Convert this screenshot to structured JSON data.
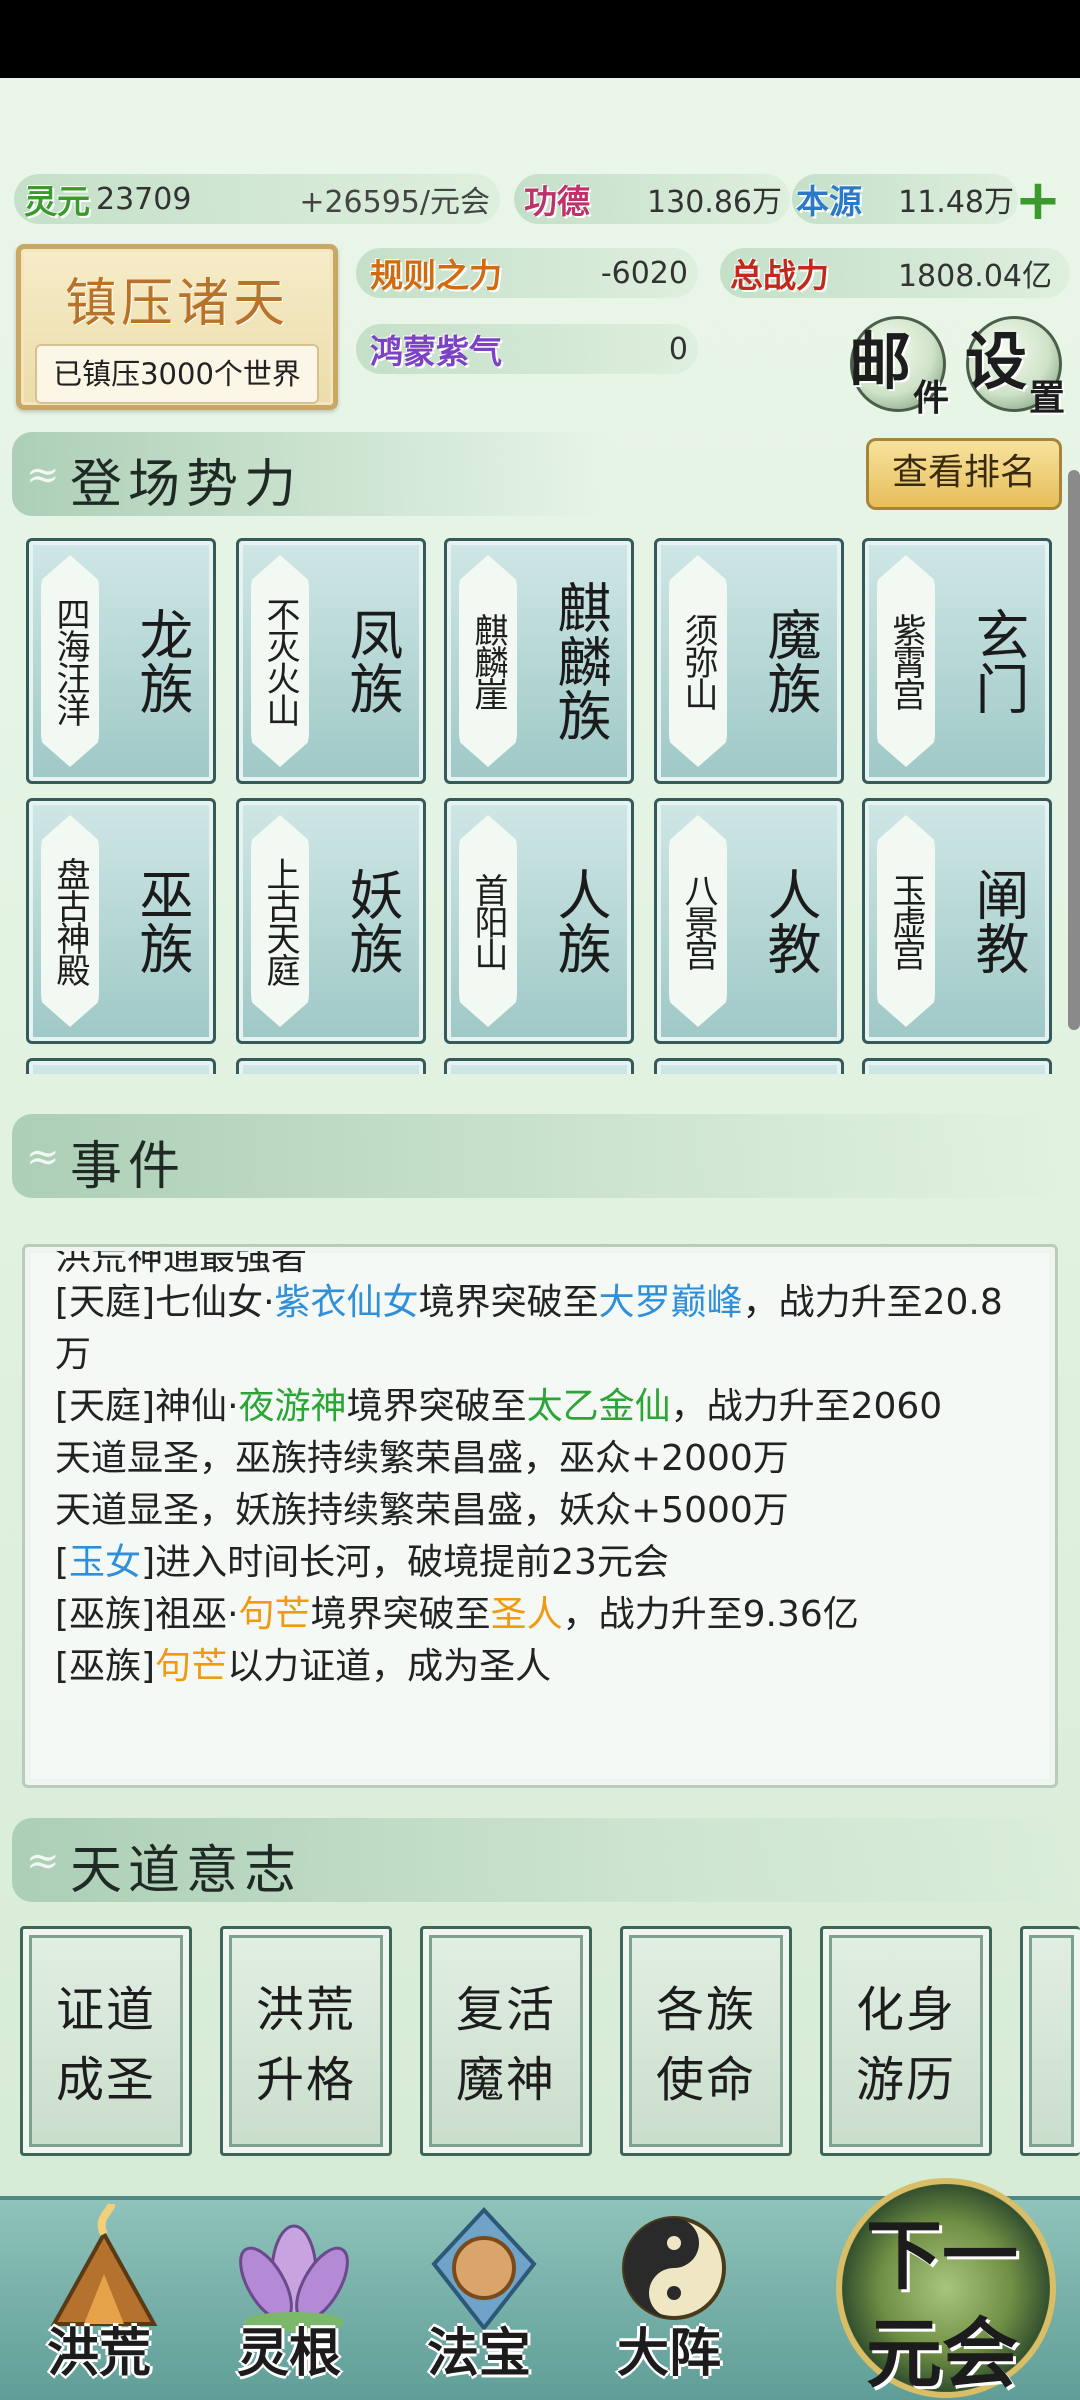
{
  "resources": {
    "lingyuan": {
      "label": "灵元",
      "value": "23709",
      "rate": "+26595/元会"
    },
    "gongde": {
      "label": "功德",
      "value": "130.86万"
    },
    "benyuan": {
      "label": "本源",
      "value": "11.48万"
    },
    "guize": {
      "label": "规则之力",
      "value": "-6020"
    },
    "zongzhanli": {
      "label": "总战力",
      "value": "1808.04亿"
    },
    "hongmeng": {
      "label": "鸿蒙紫气",
      "value": "0"
    }
  },
  "suppress": {
    "title": "镇压诸天",
    "subtitle": "已镇压3000个世界"
  },
  "buttons": {
    "mail": {
      "big": "邮",
      "small": "件"
    },
    "settings": {
      "big": "设",
      "small": "置"
    },
    "plus": "+"
  },
  "factions_section": {
    "title": "登场势力",
    "rank_button": "查看排名"
  },
  "factions": [
    {
      "place": "四海汪洋",
      "name": "龙族"
    },
    {
      "place": "不灭火山",
      "name": "凤族"
    },
    {
      "place": "麒麟崖",
      "name": "麒麟族"
    },
    {
      "place": "须弥山",
      "name": "魔族"
    },
    {
      "place": "紫霄宫",
      "name": "玄门"
    },
    {
      "place": "盘古神殿",
      "name": "巫族"
    },
    {
      "place": "上古天庭",
      "name": "妖族"
    },
    {
      "place": "首阳山",
      "name": "人族"
    },
    {
      "place": "八景宫",
      "name": "人教"
    },
    {
      "place": "玉虚宫",
      "name": "阐教"
    }
  ],
  "events_section": {
    "title": "事件"
  },
  "events": {
    "cut_line": "洪荒神通最强者",
    "e1": {
      "a": "[天庭]七仙女·",
      "b": "紫衣仙女",
      "c": "境界突破至",
      "d": "大罗巅峰",
      "e": "，战力升至20.8万"
    },
    "e2": {
      "a": "[天庭]神仙·",
      "b": "夜游神",
      "c": "境界突破至",
      "d": "太乙金仙",
      "e": "，战力升至2060"
    },
    "e3": "天道显圣，巫族持续繁荣昌盛，巫众+2000万",
    "e4": "天道显圣，妖族持续繁荣昌盛，妖众+5000万",
    "e5": {
      "a": "[",
      "b": "玉女",
      "c": "]进入时间长河，破境提前23元会"
    },
    "e6": {
      "a": "[巫族]祖巫·",
      "b": "句芒",
      "c": "境界突破至",
      "d": "圣人",
      "e": "，战力升至9.36亿"
    },
    "e7": {
      "a": "[巫族]",
      "b": "句芒",
      "c": "以力证道，成为圣人"
    }
  },
  "will_section": {
    "title": "天道意志"
  },
  "will_actions": [
    {
      "l1": "证道",
      "l2": "成圣"
    },
    {
      "l1": "洪荒",
      "l2": "升格"
    },
    {
      "l1": "复活",
      "l2": "魔神"
    },
    {
      "l1": "各族",
      "l2": "使命"
    },
    {
      "l1": "化身",
      "l2": "游历"
    }
  ],
  "nav": {
    "honghuang": "洪荒",
    "linggen": "灵根",
    "fabao": "法宝",
    "dazhen": "大阵",
    "next": {
      "l1": "下一",
      "l2": "元会"
    }
  },
  "colors": {
    "accent_green": "#3a9a2c",
    "event_blue": "#2f8fd9",
    "event_green": "#2ba536",
    "event_orange": "#f09a10"
  }
}
